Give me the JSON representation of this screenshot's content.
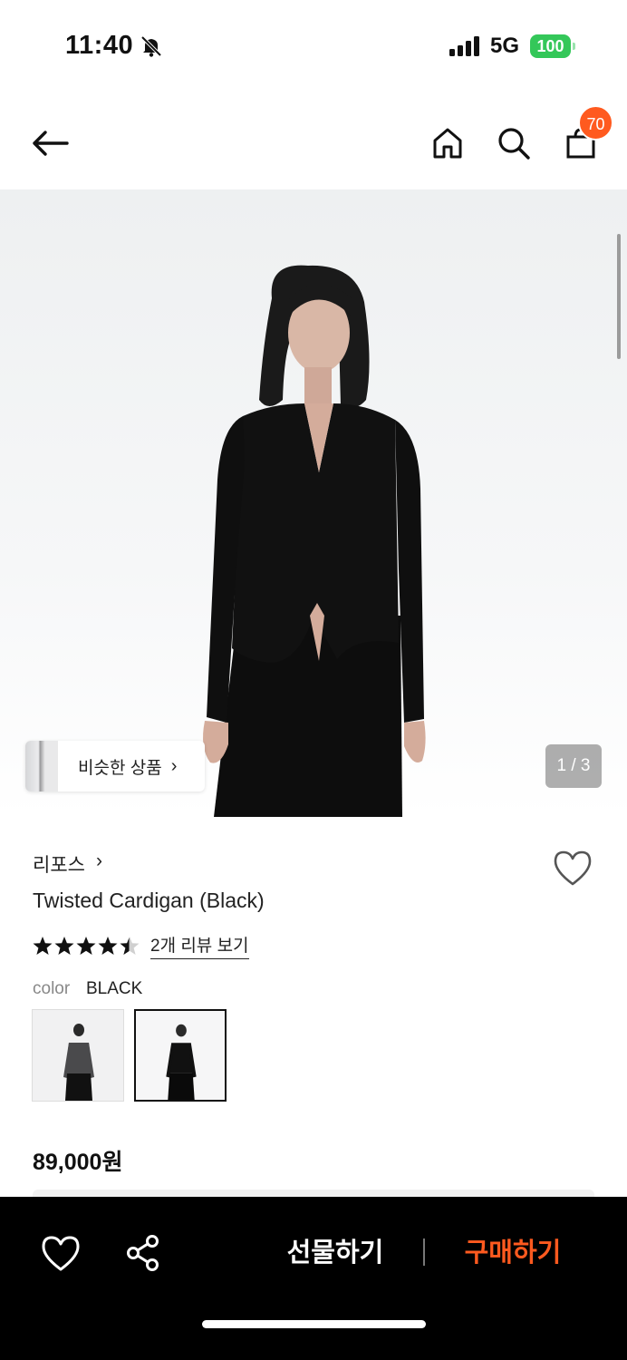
{
  "status_bar": {
    "time": "11:40",
    "network": "5G",
    "battery": "100",
    "icons": [
      "bell-slash-icon",
      "signal-icon",
      "battery-icon"
    ]
  },
  "header": {
    "cart_count": "70",
    "icons": [
      "back-arrow-icon",
      "home-icon",
      "search-icon",
      "shopping-bag-icon"
    ]
  },
  "gallery": {
    "similar_label": "비슷한 상품",
    "similar_chevron": "›",
    "counter": "1 / 3"
  },
  "product": {
    "brand": "리포스",
    "brand_chevron": "›",
    "title": "Twisted Cardigan (Black)",
    "rating": 4.5,
    "rating_max": 5,
    "review_link": "2개 리뷰 보기",
    "color_label": "color",
    "color_value": "BLACK",
    "price": "89,000원"
  },
  "bottom_bar": {
    "gift_label": "선물하기",
    "buy_label": "구매하기",
    "accent_color": "#ff5a1f",
    "icons": [
      "heart-icon",
      "share-icon"
    ]
  }
}
